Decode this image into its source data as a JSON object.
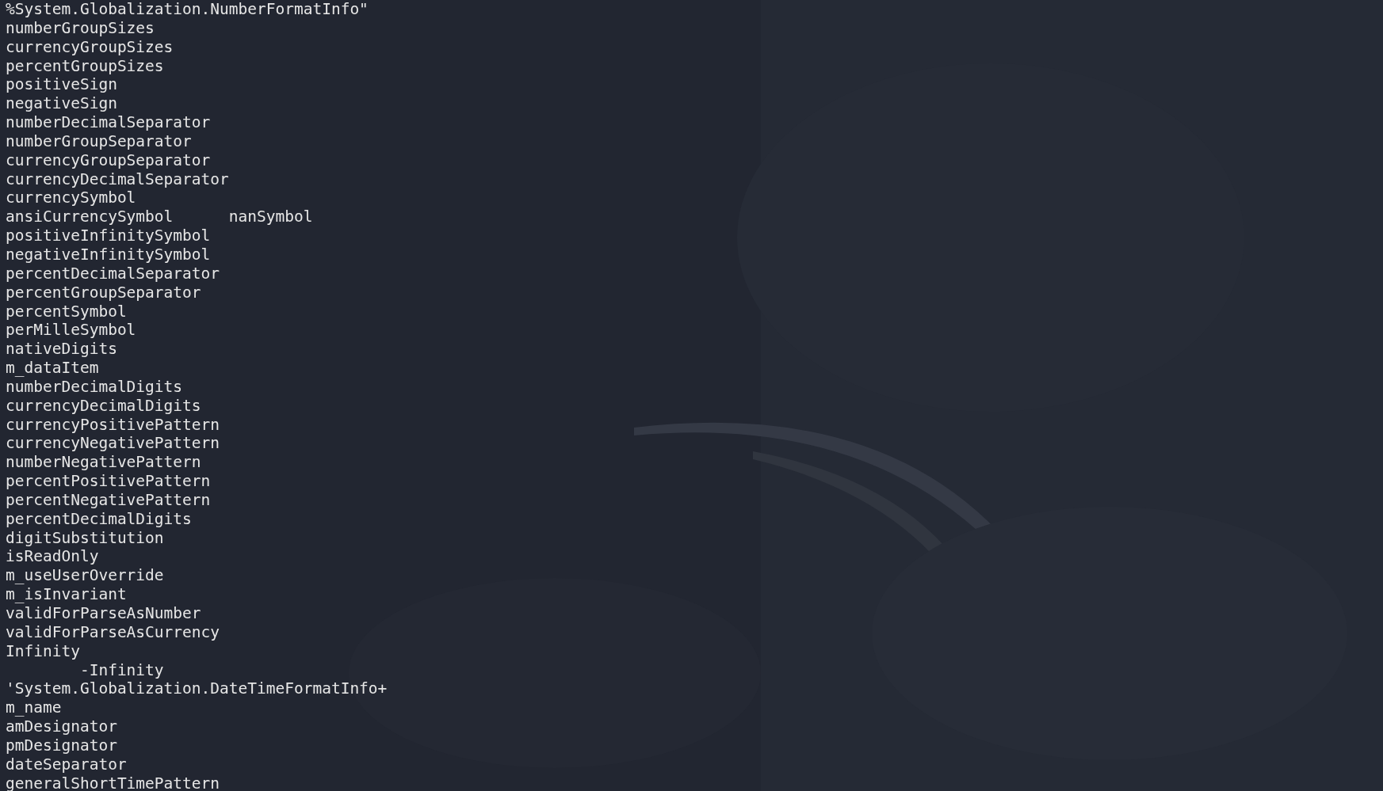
{
  "terminal": {
    "lines": [
      {
        "text": "%System.Globalization.NumberFormatInfo\""
      },
      {
        "text": "numberGroupSizes"
      },
      {
        "text": "currencyGroupSizes"
      },
      {
        "text": "percentGroupSizes"
      },
      {
        "text": "positiveSign"
      },
      {
        "text": "negativeSign"
      },
      {
        "text": "numberDecimalSeparator"
      },
      {
        "text": "numberGroupSeparator"
      },
      {
        "text": "currencyGroupSeparator"
      },
      {
        "text": "currencyDecimalSeparator"
      },
      {
        "text": "currencySymbol"
      },
      {
        "text": "ansiCurrencySymbol",
        "after_tab": "nanSymbol"
      },
      {
        "text": "positiveInfinitySymbol"
      },
      {
        "text": "negativeInfinitySymbol"
      },
      {
        "text": "percentDecimalSeparator"
      },
      {
        "text": "percentGroupSeparator"
      },
      {
        "text": "percentSymbol"
      },
      {
        "text": "perMilleSymbol"
      },
      {
        "text": "nativeDigits"
      },
      {
        "text": "m_dataItem"
      },
      {
        "text": "numberDecimalDigits"
      },
      {
        "text": "currencyDecimalDigits"
      },
      {
        "text": "currencyPositivePattern"
      },
      {
        "text": "currencyNegativePattern"
      },
      {
        "text": "numberNegativePattern"
      },
      {
        "text": "percentPositivePattern"
      },
      {
        "text": "percentNegativePattern"
      },
      {
        "text": "percentDecimalDigits"
      },
      {
        "text": "digitSubstitution"
      },
      {
        "text": "isReadOnly"
      },
      {
        "text": "m_useUserOverride"
      },
      {
        "text": "m_isInvariant"
      },
      {
        "text": "validForParseAsNumber"
      },
      {
        "text": "validForParseAsCurrency"
      },
      {
        "text": "Infinity"
      },
      {
        "after_tab": "-Infinity"
      },
      {
        "text": "'System.Globalization.DateTimeFormatInfo+"
      },
      {
        "text": "m_name"
      },
      {
        "text": "amDesignator"
      },
      {
        "text": "pmDesignator"
      },
      {
        "text": "dateSeparator"
      },
      {
        "text": "generalShortTimePattern"
      }
    ]
  }
}
